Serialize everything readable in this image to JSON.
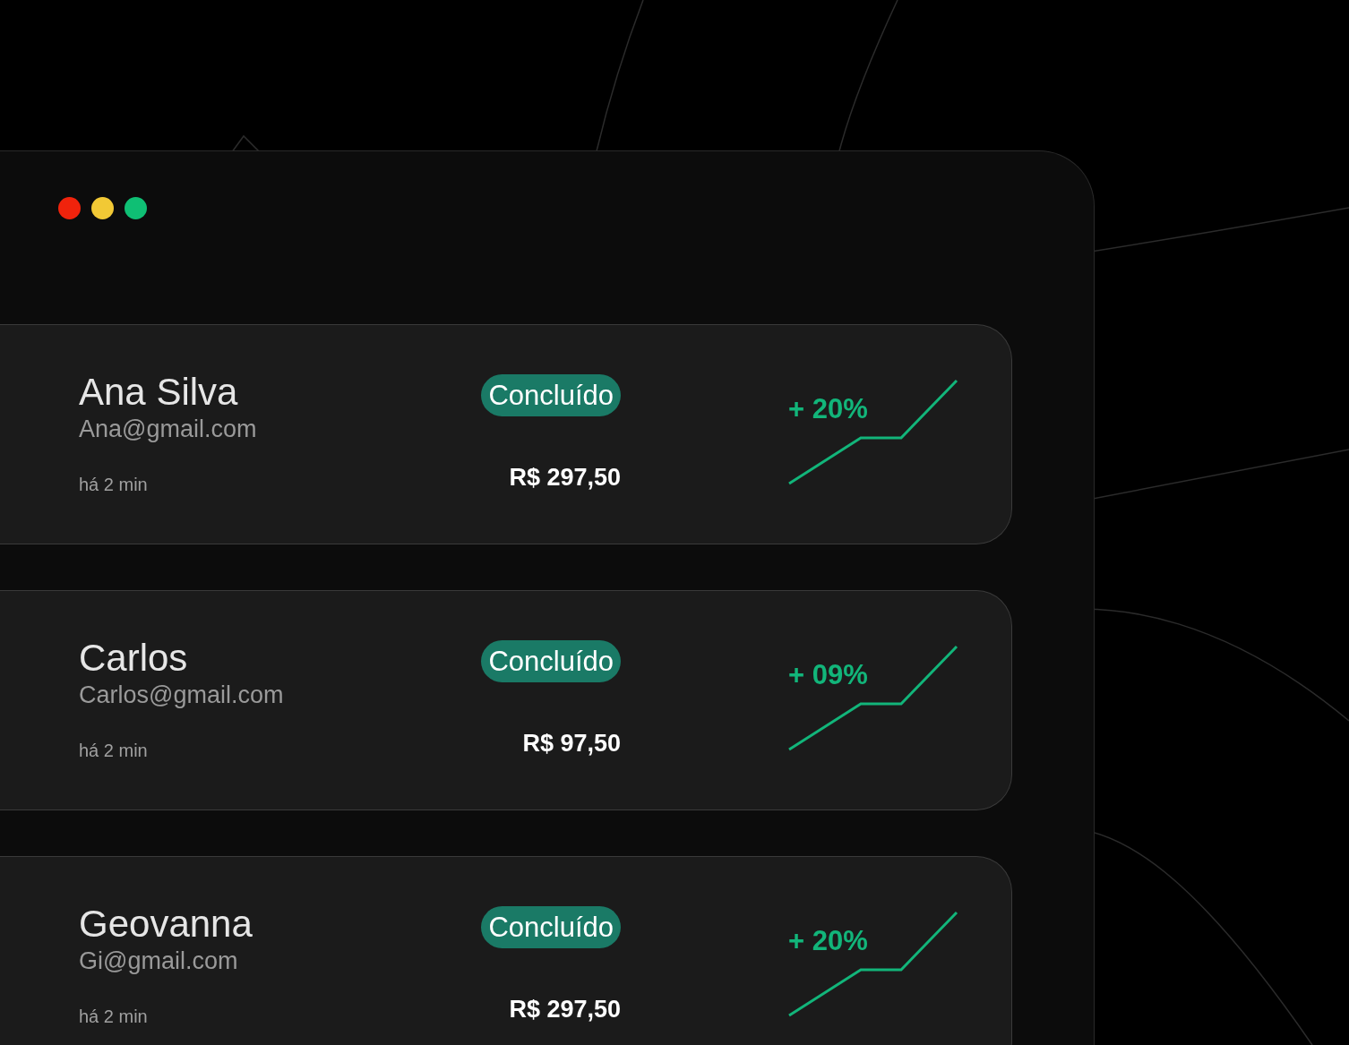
{
  "window": {
    "controls": [
      {
        "color": "#f0230c"
      },
      {
        "color": "#f2c935"
      },
      {
        "color": "#0fbf74"
      }
    ]
  },
  "cards": [
    {
      "name": "Ana Silva",
      "email": "Ana@gmail.com",
      "time": "há 2 min",
      "status": "Concluído",
      "amount": "R$ 297,50",
      "change": "+ 20%"
    },
    {
      "name": "Carlos",
      "email": "Carlos@gmail.com",
      "time": "há 2 min",
      "status": "Concluído",
      "amount": "R$ 97,50",
      "change": "+ 09%"
    },
    {
      "name": "Geovanna",
      "email": "Gi@gmail.com",
      "time": "há 2 min",
      "status": "Concluído",
      "amount": "R$ 297,50",
      "change": "+ 20%"
    }
  ]
}
